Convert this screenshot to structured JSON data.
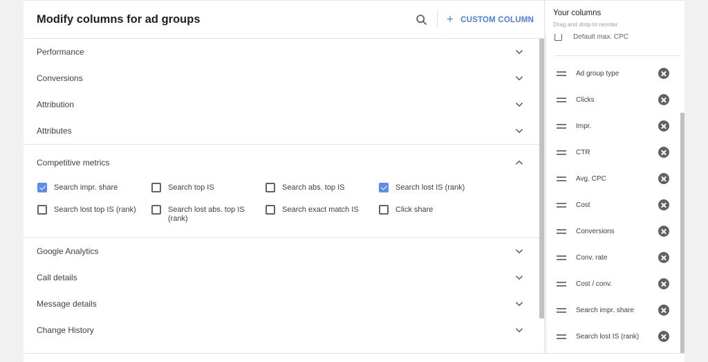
{
  "header": {
    "title": "Modify columns for ad groups",
    "search_icon": "search-icon",
    "custom_column_label": "CUSTOM COLUMN",
    "custom_column_icon": "plus-icon"
  },
  "colors": {
    "accent": "#4a7fe0",
    "checkbox_checked": "#5b8def",
    "remove_icon": "#616161"
  },
  "sections_top": [
    {
      "label": "Performance",
      "expanded": false
    },
    {
      "label": "Conversions",
      "expanded": false
    },
    {
      "label": "Attribution",
      "expanded": false
    },
    {
      "label": "Attributes",
      "expanded": false
    }
  ],
  "competitive": {
    "label": "Competitive metrics",
    "expanded": true,
    "options": [
      {
        "label": "Search impr. share",
        "checked": true
      },
      {
        "label": "Search top IS",
        "checked": false
      },
      {
        "label": "Search abs. top IS",
        "checked": false
      },
      {
        "label": "Search lost IS (rank)",
        "checked": true
      },
      {
        "label": "Search lost top IS (rank)",
        "checked": false
      },
      {
        "label": "Search lost abs. top IS (rank)",
        "checked": false
      },
      {
        "label": "Search exact match IS",
        "checked": false
      },
      {
        "label": "Click share",
        "checked": false
      }
    ]
  },
  "sections_bottom": [
    {
      "label": "Google Analytics",
      "expanded": false
    },
    {
      "label": "Call details",
      "expanded": false
    },
    {
      "label": "Message details",
      "expanded": false
    },
    {
      "label": "Change History",
      "expanded": false
    }
  ],
  "your_columns": {
    "title": "Your columns",
    "subtitle": "Drag and drop to reorder",
    "partial_item": "Default max. CPC",
    "items": [
      "Ad group type",
      "Clicks",
      "Impr.",
      "CTR",
      "Avg. CPC",
      "Cost",
      "Conversions",
      "Conv. rate",
      "Cost / conv.",
      "Search impr. share",
      "Search lost IS (rank)"
    ]
  }
}
